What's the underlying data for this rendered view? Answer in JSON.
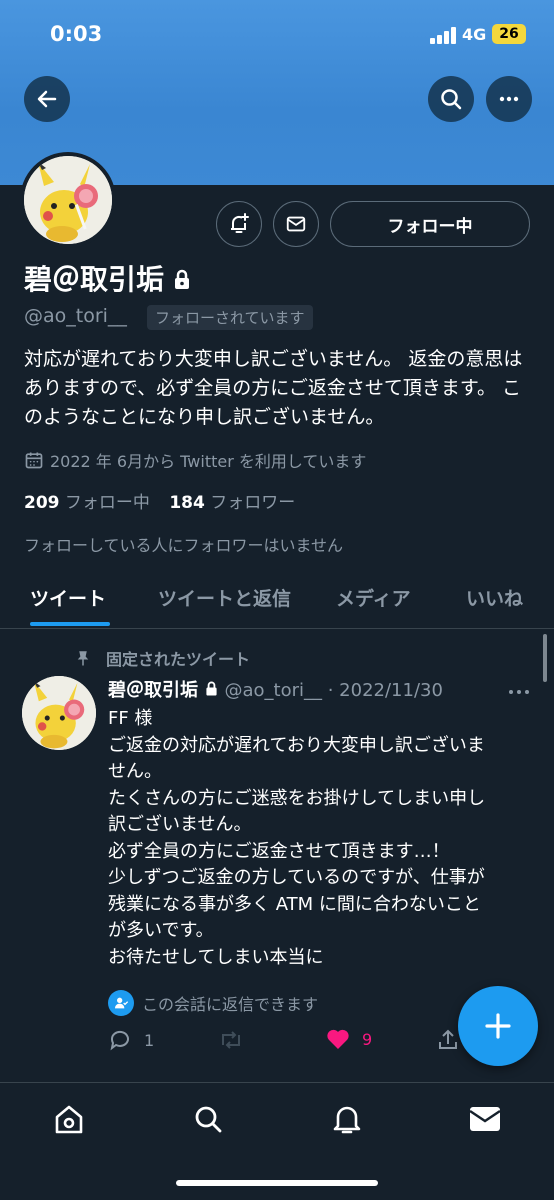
{
  "status_bar": {
    "time": "0:03",
    "network": "4G",
    "battery": "26"
  },
  "profile": {
    "name": "碧＠取引垢",
    "handle": "@ao_tori__",
    "follows_you": "フォローされています",
    "bio": "対応が遅れており大変申し訳ございません。 返金の意思はありますので、必ず全員の方にご返金させて頂きます。 このようなことになり申し訳ございません。",
    "joined": "2022 年 6月から Twitter を利用しています",
    "following_count": "209",
    "following_label": "フォロー中",
    "followers_count": "184",
    "followers_label": "フォロワー",
    "no_mutual_followers": "フォローしている人にフォロワーはいません",
    "follow_button": "フォロー中"
  },
  "tabs": [
    {
      "label": "ツイート"
    },
    {
      "label": "ツイートと返信"
    },
    {
      "label": "メディア"
    },
    {
      "label": "いいね"
    }
  ],
  "pinned_tweet": {
    "pinned_label": "固定されたツイート",
    "name": "碧＠取引垢",
    "handle": "@ao_tori__",
    "date": "· 2022/11/30",
    "lines": [
      "FF 様",
      "ご返金の対応が遅れており大変申し訳ございま",
      "せん。",
      "たくさんの方にご迷惑をお掛けしてしまい申し",
      "訳ございません。",
      "必ず全員の方にご返金させて頂きます…！",
      "少しずつご返金の方しているのですが、仕事が",
      "残業になる事が多く ATM に間に合わないこと",
      "が多いです。",
      "お待たせしてしまい本当に"
    ],
    "reply_note": "この会話に返信できます",
    "reply_count": "1",
    "like_count": "9"
  },
  "colors": {
    "accent": "#1d9bf0",
    "like": "#f91880",
    "background": "#15202b",
    "banner": "#4a96df"
  },
  "icons": [
    "back-icon",
    "search-icon",
    "more-icon",
    "notification-add-icon",
    "mail-icon",
    "lock-icon",
    "calendar-icon",
    "pin-icon",
    "reply-icon",
    "retweet-icon",
    "heart-icon",
    "share-icon",
    "compose-icon",
    "home-icon",
    "bell-icon",
    "envelope-icon"
  ]
}
